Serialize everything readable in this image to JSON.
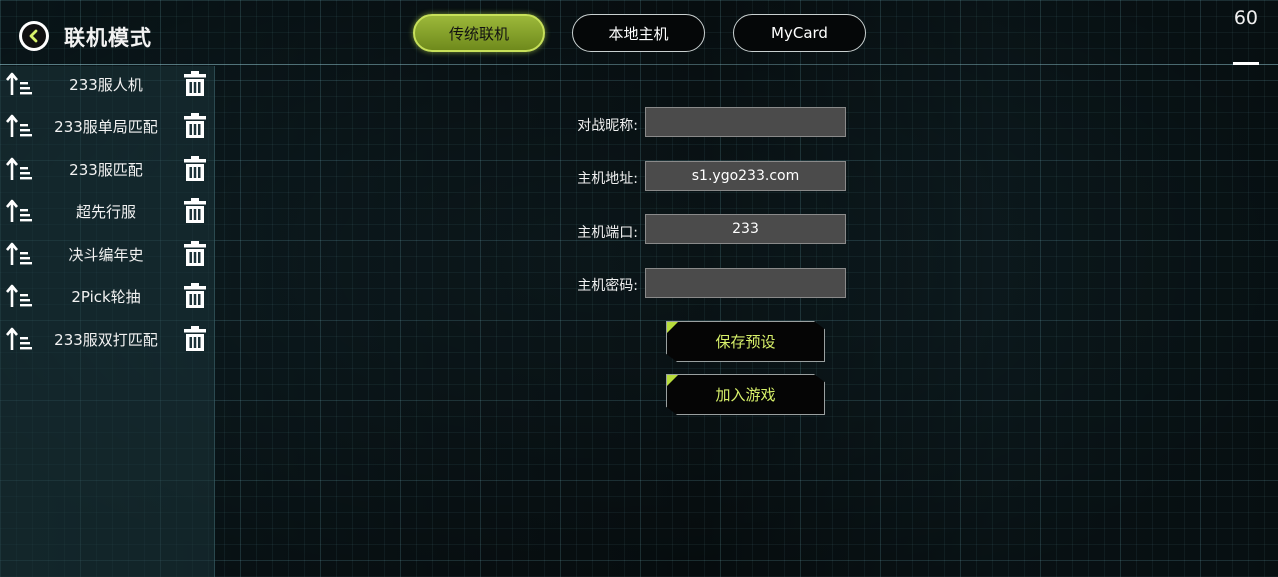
{
  "header": {
    "title": "联机模式",
    "fps": "60"
  },
  "tabs": [
    {
      "label": "传统联机",
      "active": true
    },
    {
      "label": "本地主机",
      "active": false
    },
    {
      "label": "MyCard",
      "active": false
    }
  ],
  "sidebar": {
    "items": [
      {
        "label": "233服人机"
      },
      {
        "label": "233服单局匹配"
      },
      {
        "label": "233服匹配"
      },
      {
        "label": "超先行服"
      },
      {
        "label": "决斗编年史"
      },
      {
        "label": "2Pick轮抽"
      },
      {
        "label": "233服双打匹配"
      }
    ]
  },
  "form": {
    "nickname": {
      "label": "对战昵称:",
      "value": ""
    },
    "host": {
      "label": "主机地址:",
      "value": "s1.ygo233.com"
    },
    "port": {
      "label": "主机端口:",
      "value": "233"
    },
    "password": {
      "label": "主机密码:",
      "value": ""
    }
  },
  "actions": {
    "save_label": "保存预设",
    "join_label": "加入游戏"
  },
  "colors": {
    "accent": "#b8dc3c",
    "active_tab": "#8fae2e",
    "button_text": "#d7f06a"
  }
}
